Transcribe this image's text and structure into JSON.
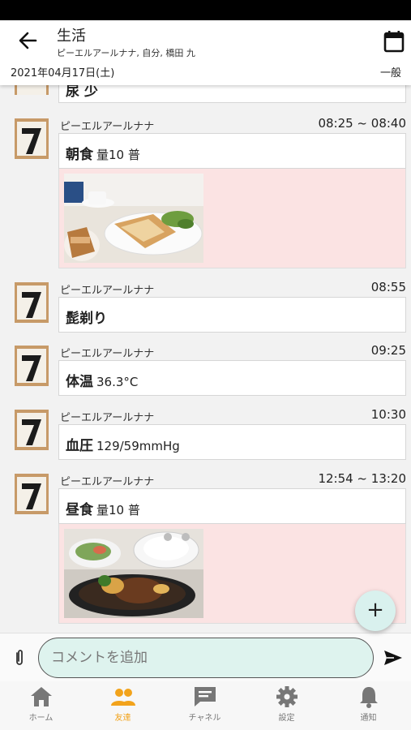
{
  "header": {
    "title": "生活",
    "participants": "ピーエルアールナナ, 自分, 橋田 九",
    "date": "2021年04月17日(土)",
    "mode": "一般"
  },
  "partial_entry": {
    "text": "尿 少"
  },
  "entries": [
    {
      "author": "ピーエルアールナナ",
      "time": "08:25 ~ 08:40",
      "title": "朝食",
      "detail": "量10 普",
      "photo": "breakfast-photo"
    },
    {
      "author": "ピーエルアールナナ",
      "time": "08:55",
      "title": "髭剃り",
      "detail": ""
    },
    {
      "author": "ピーエルアールナナ",
      "time": "09:25",
      "title": "体温",
      "detail": "36.3°C"
    },
    {
      "author": "ピーエルアールナナ",
      "time": "10:30",
      "title": "血圧",
      "detail": "129/59mmHg"
    },
    {
      "author": "ピーエルアールナナ",
      "time": "12:54 ~ 13:20",
      "title": "昼食",
      "detail": "量10 普",
      "photo": "lunch-photo"
    }
  ],
  "fab": {
    "label": "+"
  },
  "composer": {
    "placeholder": "コメントを追加"
  },
  "tabs": [
    {
      "label": "ホーム",
      "icon": "home-icon"
    },
    {
      "label": "友達",
      "icon": "friends-icon",
      "active": true
    },
    {
      "label": "チャネル",
      "icon": "chat-icon"
    },
    {
      "label": "設定",
      "icon": "gear-icon"
    },
    {
      "label": "通知",
      "icon": "bell-icon"
    }
  ],
  "colors": {
    "accent": "#f2a31b",
    "photo_background": "#fbe3e3",
    "comment_field": "#def3ee",
    "fab": "#d9f1ee"
  }
}
